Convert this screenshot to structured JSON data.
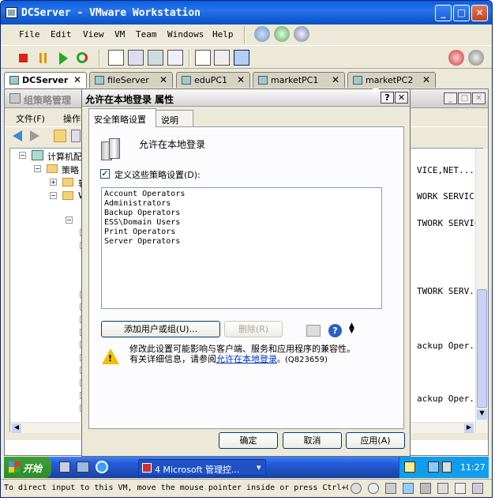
{
  "window": {
    "title": "DCServer - VMware Workstation",
    "min": "_",
    "max": "□",
    "close": "✕"
  },
  "menu": [
    "File",
    "Edit",
    "View",
    "VM",
    "Team",
    "Windows",
    "Help"
  ],
  "tabs": [
    {
      "label": "DCServer",
      "close": "✕"
    },
    {
      "label": "fileServer",
      "close": "✕"
    },
    {
      "label": "eduPC1",
      "close": "✕"
    },
    {
      "label": "marketPC1",
      "close": "✕"
    },
    {
      "label": "marketPC2",
      "close": "✕"
    }
  ],
  "gpe": {
    "title": "组策略管理",
    "menu_file": "文件(F)",
    "menu_action": "操作",
    "tree_root": "计算机配",
    "tree_policy": "策略",
    "tree_sw": "软",
    "tree_win": "Wi",
    "right_col": [
      "VICE,NET...",
      "WORK SERVICE",
      "TWORK SERVICE",
      "TWORK SERV...",
      "ackup Oper...",
      "ackup Oper..."
    ]
  },
  "dialog": {
    "title": "允许在本地登录  属性",
    "help": "?",
    "close": "✕",
    "tab_security": "安全策略设置",
    "tab_explain": "说明",
    "policy_name": "允许在本地登录",
    "define_label": "定义这些策略设置(D):",
    "checked": true,
    "accounts": [
      "Account Operators",
      "Administrators",
      "Backup Operators",
      "ESS\\Domain Users",
      "Print Operators",
      "Server Operators"
    ],
    "add_button": "添加用户或组(U)...",
    "remove_button": "删除(R)",
    "warning_line1": "修改此设置可能影响与客户端、服务和应用程序的兼容性。",
    "warning_line2_prefix": "有关详细信息，请参阅",
    "warning_link": "允许在本地登录",
    "warning_kb": "。(Q823659)",
    "ok": "确定",
    "cancel": "取消",
    "apply": "应用(A)"
  },
  "taskbar": {
    "start": "开始",
    "task": "4 Microsoft 管理控...",
    "task_arrow": "▾",
    "time": "11:27"
  },
  "status": "To direct input to this VM, move the mouse pointer inside or press Ctrl+G."
}
